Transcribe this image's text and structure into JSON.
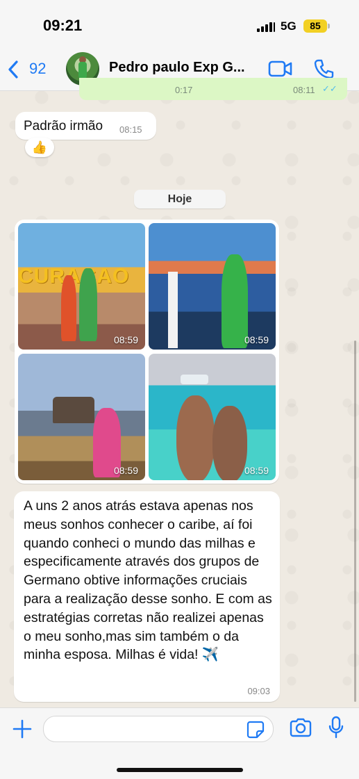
{
  "status_bar": {
    "time": "09:21",
    "network": "5G",
    "battery": "85"
  },
  "header": {
    "back_count": "92",
    "contact_name": "Pedro paulo Exp G..."
  },
  "previous_message": {
    "duration": "0:17",
    "time": "08:11",
    "ticks": "✓✓"
  },
  "messages": [
    {
      "text": "Padrão irmão",
      "time": "08:15",
      "reaction": "👍"
    }
  ],
  "date_divider": "Hoje",
  "photos": [
    {
      "time": "08:59",
      "sign_text": "CURAÇAO"
    },
    {
      "time": "08:59"
    },
    {
      "time": "08:59"
    },
    {
      "time": "08:59"
    }
  ],
  "long_message": {
    "text": "A uns 2 anos atrás estava apenas nos meus sonhos conhecer o caribe, aí foi quando conheci o mundo das milhas e especificamente através dos grupos de Germano obtive informações cruciais para a realização desse sonho. E com as estratégias corretas não realizei apenas o meu sonho,mas sim também o da minha esposa. Milhas é vida! ✈️",
    "time": "09:03"
  },
  "icons": {
    "back": "chevron-left-icon",
    "video": "video-call-icon",
    "phone": "phone-icon",
    "plus": "plus-icon",
    "sticker": "sticker-icon",
    "camera": "camera-icon",
    "mic": "microphone-icon"
  },
  "colors": {
    "accent": "#1f7af4",
    "outgoing": "#dcf7c5",
    "battery": "#f2d024"
  }
}
